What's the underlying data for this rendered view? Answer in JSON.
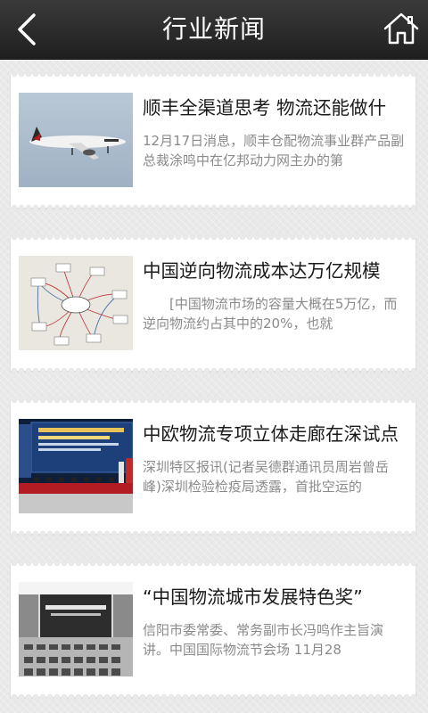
{
  "header": {
    "title": "行业新闻",
    "back_icon": "chevron-left-icon",
    "home_icon": "home-icon"
  },
  "news": [
    {
      "title": "顺丰全渠道思考 物流还能做什",
      "summary": "12月17日消息，顺丰仓配物流事业群产品副总裁涂鸣中在亿邦动力网主办的第",
      "image": "airplane-photo"
    },
    {
      "title": "中国逆向物流成本达万亿规模",
      "summary": "　　[中国物流市场的容量大概在5万亿，而逆向物流约占其中的20%，也就",
      "image": "logistics-diagram"
    },
    {
      "title": "中欧物流专项立体走廊在深试点",
      "summary": "深圳特区报讯(记者吴德群通讯员周岩曾岳峰)深圳检验检疫局透露，首批空运的",
      "image": "forum-stage-photo"
    },
    {
      "title": "“中国物流城市发展特色奖”",
      "summary": "信阳市委常委、常务副市长冯鸣作主旨演讲。中国国际物流节会场 11月28",
      "image": "conference-hall-photo"
    }
  ]
}
